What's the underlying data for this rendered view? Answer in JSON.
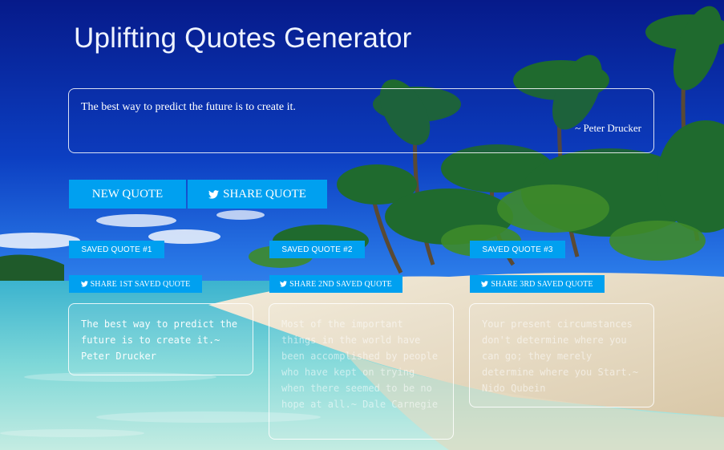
{
  "title": "Uplifting Quotes Generator",
  "current_quote": {
    "text": "The best way to predict the future is to create it.",
    "author": "~ Peter Drucker"
  },
  "buttons": {
    "new_quote": "NEW QUOTE",
    "share_quote": "SHARE QUOTE"
  },
  "saved": [
    {
      "label": "SAVED QUOTE #1",
      "share_label": "SHARE 1ST SAVED QUOTE",
      "text": "The best way to predict the future is to create it.~ Peter Drucker"
    },
    {
      "label": "SAVED QUOTE #2",
      "share_label": "SHARE 2ND SAVED QUOTE",
      "text": "Most of the important things in the world have been accomplished by people who have kept on trying when there seemed to be no hope at all.~ Dale Carnegie"
    },
    {
      "label": "SAVED QUOTE #3",
      "share_label": "SHARE 3RD SAVED QUOTE",
      "text": "Your present circumstances don't determine where you can go; they merely determine where you Start.~ Nido Qubein"
    }
  ],
  "icons": {
    "share": "twitter-icon"
  },
  "colors": {
    "accent": "#00a0f0",
    "sky_top": "#061a8a",
    "sky_bottom": "#2a7ae8",
    "sand": "#efe6d4",
    "water": "#5fd0d8"
  }
}
